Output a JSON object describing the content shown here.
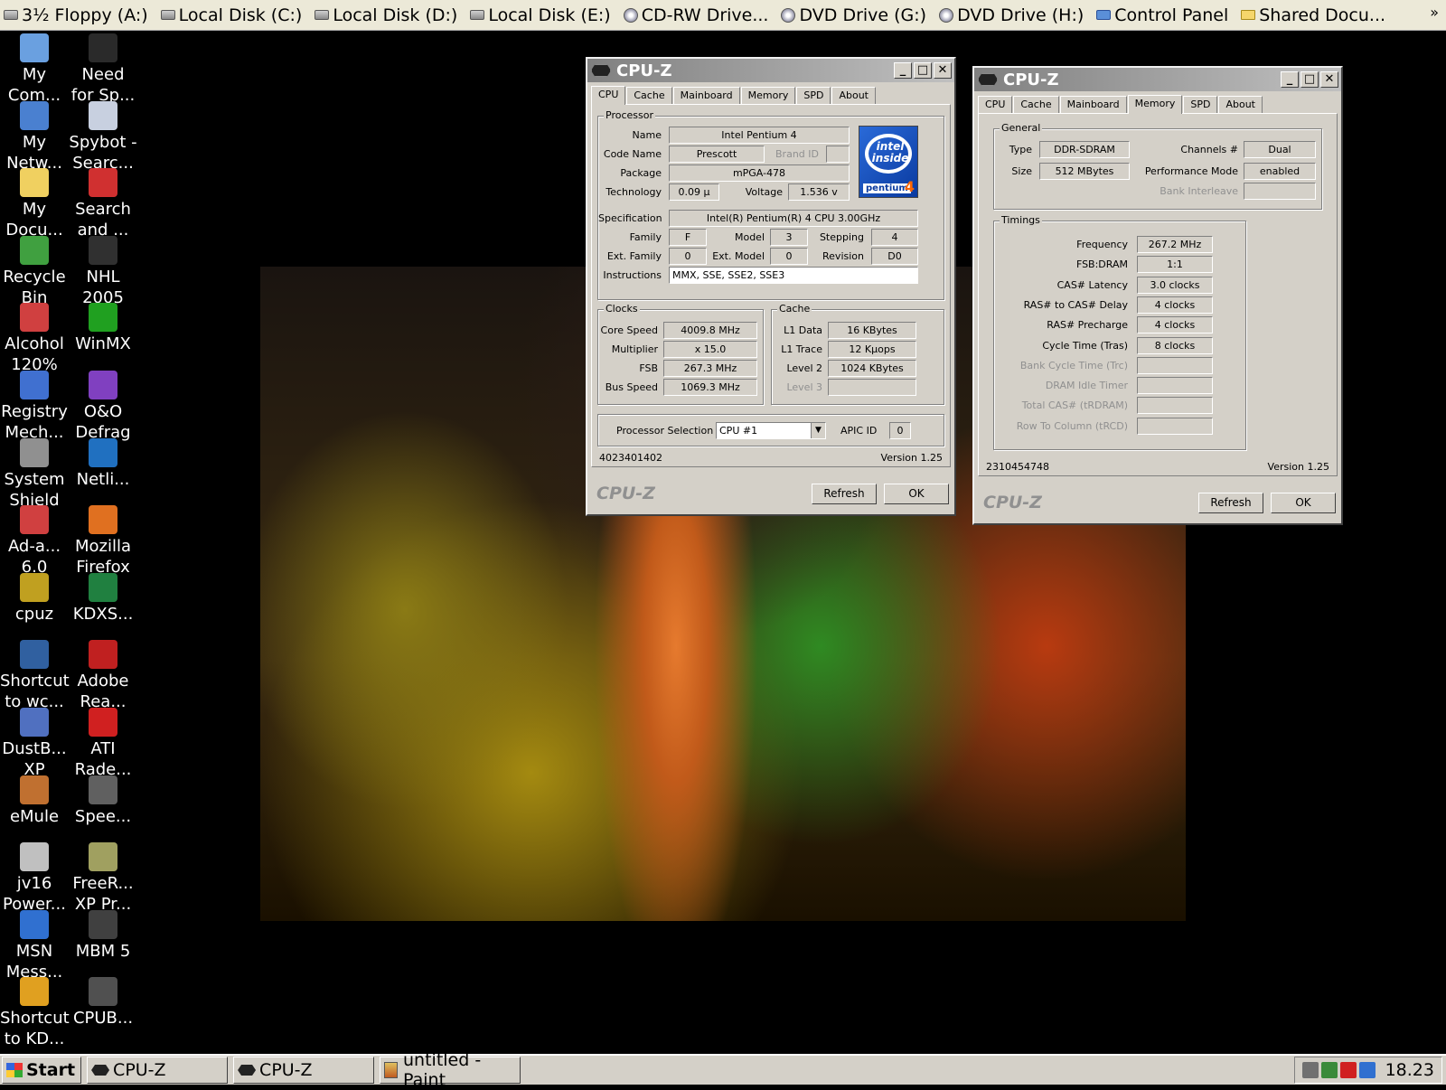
{
  "drivebar": {
    "items": [
      {
        "label": "3½ Floppy (A:)",
        "icon": "floppy-icon"
      },
      {
        "label": "Local Disk (C:)",
        "icon": "hard-disk-icon"
      },
      {
        "label": "Local Disk (D:)",
        "icon": "hard-disk-icon"
      },
      {
        "label": "Local Disk (E:)",
        "icon": "hard-disk-icon"
      },
      {
        "label": "CD-RW Drive...",
        "icon": "cd-drive-icon"
      },
      {
        "label": "DVD Drive (G:)",
        "icon": "dvd-drive-icon"
      },
      {
        "label": "DVD Drive (H:)",
        "icon": "dvd-drive-icon"
      },
      {
        "label": "Control Panel",
        "icon": "control-panel-icon"
      },
      {
        "label": "Shared Docu...",
        "icon": "folder-icon"
      }
    ],
    "more": "»"
  },
  "desktop_icons": [
    {
      "line1": "My",
      "line2": "Com...",
      "icon": "my-computer-icon",
      "color": "#6aa0e0"
    },
    {
      "line1": "Need",
      "line2": "for Sp...",
      "icon": "nfs-icon",
      "color": "#2a2a2a"
    },
    {
      "line1": "My",
      "line2": "Netw...",
      "icon": "network-icon",
      "color": "#4a80d0"
    },
    {
      "line1": "Spybot -",
      "line2": "Searc...",
      "icon": "spybot-icon",
      "color": "#c8d0e0"
    },
    {
      "line1": "My",
      "line2": "Docu...",
      "icon": "documents-icon",
      "color": "#f0d060"
    },
    {
      "line1": "Search",
      "line2": "and ...",
      "icon": "search-destroy-icon",
      "color": "#d03030"
    },
    {
      "line1": "Recycle",
      "line2": "Bin",
      "icon": "recycle-bin-icon",
      "color": "#40a040"
    },
    {
      "line1": "NHL",
      "line2": "2005",
      "icon": "nhl-icon",
      "color": "#303030"
    },
    {
      "line1": "Alcohol",
      "line2": "120%",
      "icon": "alcohol-icon",
      "color": "#d04040"
    },
    {
      "line1": "WinMX",
      "line2": "",
      "icon": "winmx-icon",
      "color": "#20a020"
    },
    {
      "line1": "Registry",
      "line2": "Mech...",
      "icon": "registry-icon",
      "color": "#4070d0"
    },
    {
      "line1": "O&O",
      "line2": "Defrag",
      "icon": "defrag-icon",
      "color": "#8040c0"
    },
    {
      "line1": "System",
      "line2": "Shield",
      "icon": "shield-icon",
      "color": "#909090"
    },
    {
      "line1": "Netli...",
      "line2": "",
      "icon": "netlimiter-icon",
      "color": "#2070c0"
    },
    {
      "line1": "Ad-a...",
      "line2": "6.0",
      "icon": "adaware-icon",
      "color": "#d04040"
    },
    {
      "line1": "Mozilla",
      "line2": "Firefox",
      "icon": "firefox-icon",
      "color": "#e07020"
    },
    {
      "line1": "cpuz",
      "line2": "",
      "icon": "cpuz-icon",
      "color": "#c0a020"
    },
    {
      "line1": "KDXS...",
      "line2": "",
      "icon": "kdx-icon",
      "color": "#208040"
    },
    {
      "line1": "Shortcut",
      "line2": "to wc...",
      "icon": "wcpu-icon",
      "color": "#3060a0"
    },
    {
      "line1": "Adobe",
      "line2": "Rea...",
      "icon": "adobe-reader-icon",
      "color": "#c02020"
    },
    {
      "line1": "DustB...",
      "line2": "XP",
      "icon": "dustbuster-icon",
      "color": "#5070c0"
    },
    {
      "line1": "ATI",
      "line2": "Rade...",
      "icon": "ati-icon",
      "color": "#d02020"
    },
    {
      "line1": "eMule",
      "line2": "",
      "icon": "emule-icon",
      "color": "#c07030"
    },
    {
      "line1": "Spee...",
      "line2": "",
      "icon": "speedfan-icon",
      "color": "#606060"
    },
    {
      "line1": "jv16",
      "line2": "Power...",
      "icon": "jv16-icon",
      "color": "#c0c0c0"
    },
    {
      "line1": "FreeR...",
      "line2": "XP Pr...",
      "icon": "freeram-icon",
      "color": "#a0a060"
    },
    {
      "line1": "MSN",
      "line2": "Mess...",
      "icon": "msn-icon",
      "color": "#3070d0"
    },
    {
      "line1": "MBM 5",
      "line2": "",
      "icon": "mbm-icon",
      "color": "#404040"
    },
    {
      "line1": "Shortcut",
      "line2": "to KD...",
      "icon": "kd-shortcut-icon",
      "color": "#e0a020"
    },
    {
      "line1": "CPUB...",
      "line2": "",
      "icon": "cpubench-icon",
      "color": "#505050"
    }
  ],
  "cpuz1": {
    "title": "CPU-Z",
    "tabs": [
      "CPU",
      "Cache",
      "Mainboard",
      "Memory",
      "SPD",
      "About"
    ],
    "active_tab": "CPU",
    "processor_group": "Processor",
    "labels": {
      "name": "Name",
      "codename": "Code Name",
      "brandid": "Brand ID",
      "package": "Package",
      "technology": "Technology",
      "voltage": "Voltage",
      "specification": "Specification",
      "family": "Family",
      "model": "Model",
      "stepping": "Stepping",
      "extfamily": "Ext. Family",
      "extmodel": "Ext. Model",
      "revision": "Revision",
      "instructions": "Instructions"
    },
    "values": {
      "name": "Intel Pentium 4",
      "codename": "Prescott",
      "brandid": "",
      "package": "mPGA-478",
      "technology": "0.09 µ",
      "voltage": "1.536 v",
      "specification": "Intel(R) Pentium(R) 4 CPU 3.00GHz",
      "family": "F",
      "model": "3",
      "stepping": "4",
      "extfamily": "0",
      "extmodel": "0",
      "revision": "D0",
      "instructions": "MMX, SSE, SSE2, SSE3"
    },
    "clocks_group": "Clocks",
    "clocks_labels": {
      "core": "Core Speed",
      "mult": "Multiplier",
      "fsb": "FSB",
      "bus": "Bus Speed"
    },
    "clocks_values": {
      "core": "4009.8 MHz",
      "mult": "x 15.0",
      "fsb": "267.3 MHz",
      "bus": "1069.3 MHz"
    },
    "cache_group": "Cache",
    "cache_labels": {
      "l1d": "L1 Data",
      "l1t": "L1 Trace",
      "l2": "Level 2",
      "l3": "Level 3"
    },
    "cache_values": {
      "l1d": "16 KBytes",
      "l1t": "12 Kµops",
      "l2": "1024 KBytes",
      "l3": ""
    },
    "proc_sel_label": "Processor Selection",
    "proc_sel_value": "CPU #1",
    "apic_label": "APIC ID",
    "apic_value": "0",
    "footer_id": "4023401402",
    "version": "Version 1.25",
    "brand": "CPU-Z",
    "refresh": "Refresh",
    "ok": "OK",
    "intel_logo": {
      "line1": "intel",
      "line2": "inside",
      "product": "pentium",
      "num": "4"
    }
  },
  "cpuz2": {
    "title": "CPU-Z",
    "tabs": [
      "CPU",
      "Cache",
      "Mainboard",
      "Memory",
      "SPD",
      "About"
    ],
    "active_tab": "Memory",
    "general_group": "General",
    "labels": {
      "type": "Type",
      "size": "Size",
      "channels": "Channels #",
      "perfmode": "Performance Mode",
      "bankinter": "Bank Interleave"
    },
    "values": {
      "type": "DDR-SDRAM",
      "size": "512 MBytes",
      "channels": "Dual",
      "perfmode": "enabled",
      "bankinter": ""
    },
    "timings_group": "Timings",
    "timings": [
      {
        "label": "Frequency",
        "value": "267.2 MHz",
        "dim": false
      },
      {
        "label": "FSB:DRAM",
        "value": "1:1",
        "dim": false
      },
      {
        "label": "CAS# Latency",
        "value": "3.0 clocks",
        "dim": false
      },
      {
        "label": "RAS# to CAS# Delay",
        "value": "4 clocks",
        "dim": false
      },
      {
        "label": "RAS# Precharge",
        "value": "4 clocks",
        "dim": false
      },
      {
        "label": "Cycle Time (Tras)",
        "value": "8 clocks",
        "dim": false
      },
      {
        "label": "Bank Cycle Time (Trc)",
        "value": "",
        "dim": true
      },
      {
        "label": "DRAM Idle Timer",
        "value": "",
        "dim": true
      },
      {
        "label": "Total CAS# (tRDRAM)",
        "value": "",
        "dim": true
      },
      {
        "label": "Row To Column (tRCD)",
        "value": "",
        "dim": true
      }
    ],
    "footer_id": "2310454748",
    "version": "Version 1.25",
    "brand": "CPU-Z",
    "refresh": "Refresh",
    "ok": "OK"
  },
  "taskbar": {
    "start": "Start",
    "tasks": [
      {
        "label": "CPU-Z",
        "icon": "cpuz-icon"
      },
      {
        "label": "CPU-Z",
        "icon": "cpuz-icon"
      },
      {
        "label": "untitled - Paint",
        "icon": "paint-icon"
      }
    ],
    "tray_icons": [
      {
        "name": "motherboard-monitor-icon",
        "color": "#707070"
      },
      {
        "name": "windows-flag-icon",
        "color": "#3a8a3a"
      },
      {
        "name": "ati-tray-icon",
        "color": "#d02020"
      },
      {
        "name": "msn-tray-icon",
        "color": "#3070d0"
      }
    ],
    "clock": "18.23"
  }
}
